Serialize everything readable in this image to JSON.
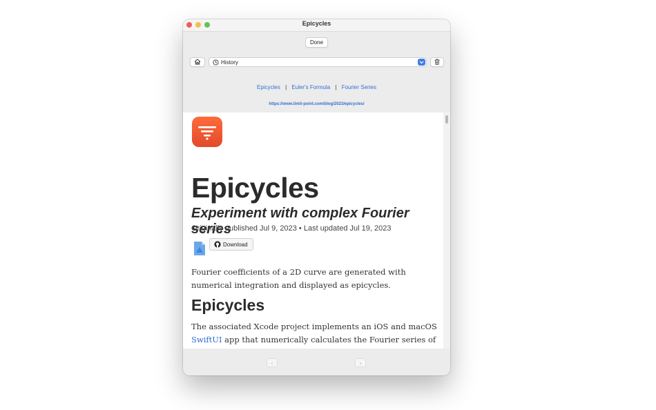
{
  "window": {
    "title": "Epicycles"
  },
  "toolbar": {
    "done_label": "Done",
    "history_label": "History"
  },
  "links": {
    "items": [
      "Epicycles",
      "Euler's Formula",
      "Fourier Series"
    ],
    "separator": "|",
    "url": "https://www.limit-point.com/blog/2023/epicycles/"
  },
  "article": {
    "title": "Epicycles",
    "subtitle": "Experiment with complex Fourier series",
    "meta": "Originally published Jul 9, 2023 • Last updated Jul 19, 2023",
    "download_label": "Download",
    "paragraph1": "Fourier coefficients of a 2D curve are generated with numerical integration and displayed as epicycles.",
    "section_heading": "Epicycles",
    "paragraph2_before": "The associated Xcode project implements an iOS and macOS ",
    "paragraph2_link": "SwiftUI",
    "paragraph2_after": " app that numerically calculates the Fourier series of"
  },
  "navigation": {
    "back_symbol": "‹",
    "forward_symbol": "›"
  },
  "colors": {
    "accent": "#2f6fd3",
    "app_icon": "#e9502e"
  }
}
